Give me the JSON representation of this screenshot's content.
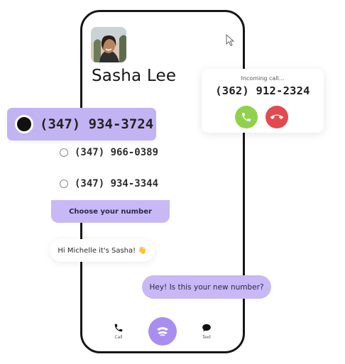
{
  "contact": {
    "name": "Sasha Lee"
  },
  "incoming_call": {
    "label": "Incoming call...",
    "number": "(362) 912-2324"
  },
  "selected_number": "(347) 934-3724",
  "number_options": [
    {
      "number": "(347) 966-0389"
    },
    {
      "number": "(347) 934-3344"
    }
  ],
  "choose_button": "Choose your number",
  "messages": {
    "received": "Hi Michelle it's Sasha!",
    "received_emoji": "👋",
    "sent": "Hey! Is this your new number?"
  },
  "nav": {
    "call_label": "Call",
    "text_label": "Text"
  },
  "colors": {
    "accent_purple": "#c2b4f3",
    "accent_purple_dark": "#a98ef0",
    "accept_green": "#90d14c",
    "decline_red": "#e24a4f"
  }
}
